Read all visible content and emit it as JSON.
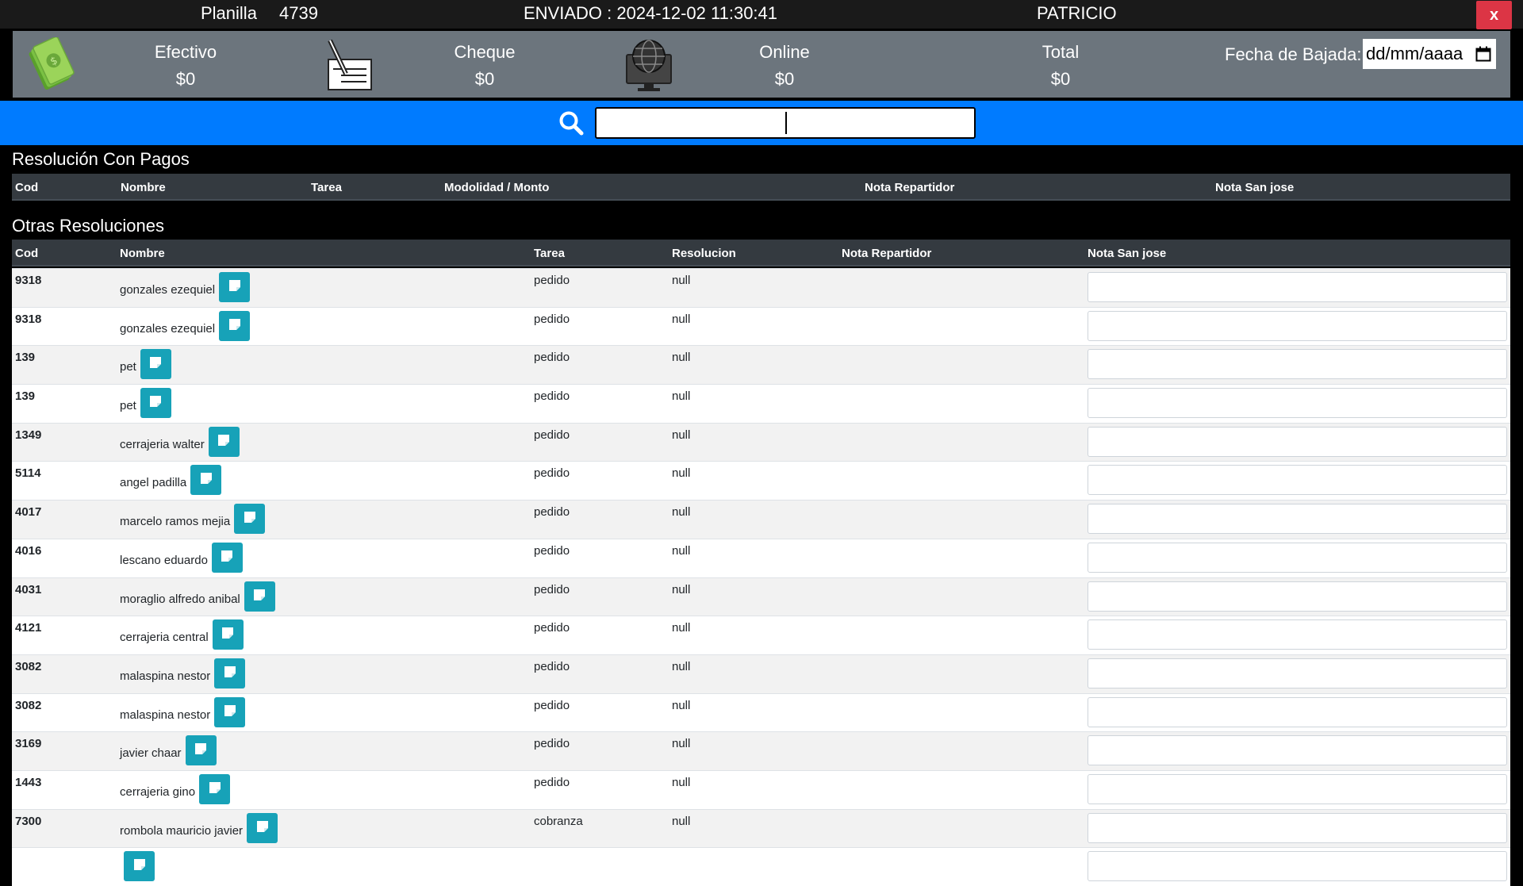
{
  "header": {
    "planilla_label": "Planilla",
    "planilla_number": "4739",
    "status": "ENVIADO : 2024-12-02 11:30:41",
    "user": "PATRICIO",
    "close_label": "x"
  },
  "summary": {
    "efectivo_label": "Efectivo",
    "efectivo_value": "$0",
    "cheque_label": "Cheque",
    "cheque_value": "$0",
    "online_label": "Online",
    "online_value": "$0",
    "total_label": "Total",
    "total_value": "$0",
    "fecha_label": "Fecha de Bajada:",
    "fecha_placeholder": "dd/mm/aaaa"
  },
  "search": {
    "value": ""
  },
  "section_pagos": {
    "title": "Resolución Con Pagos",
    "columns": [
      "Cod",
      "Nombre",
      "Tarea",
      "Modolidad / Monto",
      "Nota Repartidor",
      "Nota San jose"
    ]
  },
  "section_otras": {
    "title": "Otras Resoluciones",
    "columns": [
      "Cod",
      "Nombre",
      "Tarea",
      "Resolucion",
      "Nota Repartidor",
      "Nota San jose"
    ],
    "rows": [
      {
        "cod": "9318",
        "nombre": "gonzales ezequiel",
        "tarea": "pedido",
        "resolucion": "null"
      },
      {
        "cod": "9318",
        "nombre": "gonzales ezequiel",
        "tarea": "pedido",
        "resolucion": "null"
      },
      {
        "cod": "139",
        "nombre": "pet",
        "tarea": "pedido",
        "resolucion": "null"
      },
      {
        "cod": "139",
        "nombre": "pet",
        "tarea": "pedido",
        "resolucion": "null"
      },
      {
        "cod": "1349",
        "nombre": "cerrajeria walter",
        "tarea": "pedido",
        "resolucion": "null"
      },
      {
        "cod": "5114",
        "nombre": "angel padilla",
        "tarea": "pedido",
        "resolucion": "null"
      },
      {
        "cod": "4017",
        "nombre": "marcelo ramos mejia",
        "tarea": "pedido",
        "resolucion": "null"
      },
      {
        "cod": "4016",
        "nombre": "lescano eduardo",
        "tarea": "pedido",
        "resolucion": "null"
      },
      {
        "cod": "4031",
        "nombre": "moraglio alfredo anibal",
        "tarea": "pedido",
        "resolucion": "null"
      },
      {
        "cod": "4121",
        "nombre": "cerrajeria central",
        "tarea": "pedido",
        "resolucion": "null"
      },
      {
        "cod": "3082",
        "nombre": "malaspina nestor",
        "tarea": "pedido",
        "resolucion": "null"
      },
      {
        "cod": "3082",
        "nombre": "malaspina nestor",
        "tarea": "pedido",
        "resolucion": "null"
      },
      {
        "cod": "3169",
        "nombre": "javier chaar",
        "tarea": "pedido",
        "resolucion": "null"
      },
      {
        "cod": "1443",
        "nombre": "cerrajeria gino",
        "tarea": "pedido",
        "resolucion": "null"
      },
      {
        "cod": "7300",
        "nombre": "rombola mauricio javier",
        "tarea": "cobranza",
        "resolucion": "null"
      },
      {
        "cod": "",
        "nombre": "",
        "tarea": "",
        "resolucion": ""
      }
    ]
  }
}
